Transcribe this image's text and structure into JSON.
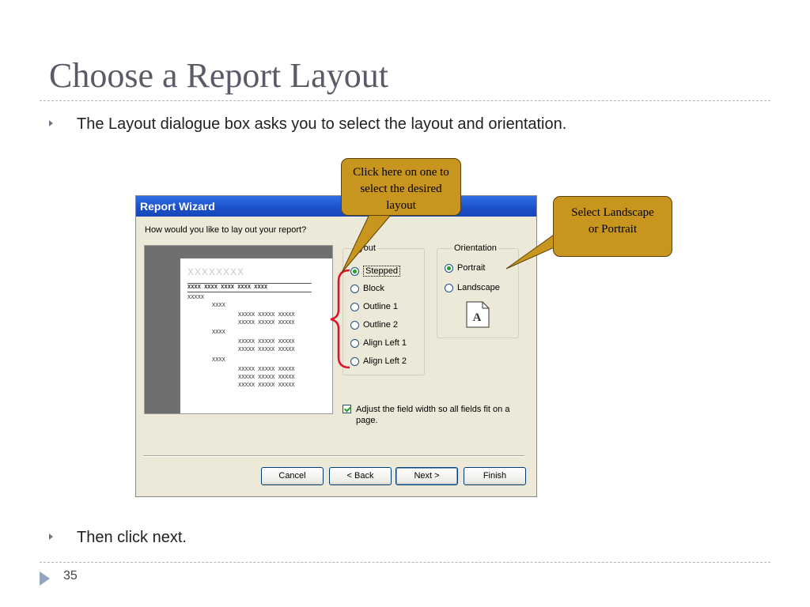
{
  "slide": {
    "title": "Choose a Report Layout",
    "bullet1": "The Layout dialogue box asks you to select the layout and orientation.",
    "bullet2": "Then click next.",
    "page_number": "35"
  },
  "dialog": {
    "title": "Report Wizard",
    "question": "How would you like to lay out your report?",
    "preview": {
      "title_placeholder": "XXXXXXXX",
      "header_row": "XXXX  XXXX  XXXX  XXXX  XXXX",
      "group_label": "XXXXX",
      "subgroup_label": "XXXX",
      "detail_row": "XXXXX  XXXXX  XXXXX"
    },
    "layout": {
      "label": "ayout",
      "options": [
        "Stepped",
        "Block",
        "Outline 1",
        "Outline 2",
        "Align Left 1",
        "Align Left 2"
      ],
      "selected": "Stepped"
    },
    "orientation": {
      "label": "Orientation",
      "options": [
        "Portrait",
        "Landscape"
      ],
      "selected": "Portrait",
      "icon_letter": "A"
    },
    "adjust_checkbox": {
      "label": "Adjust the field width so all fields fit on a page.",
      "checked": true
    },
    "buttons": {
      "cancel": "Cancel",
      "back": "< Back",
      "next": "Next >",
      "finish": "Finish"
    }
  },
  "callouts": {
    "layout_text": "Click here on one to select the desired layout",
    "orientation_text": "Select Landscape or Portrait",
    "fill_color": "#c8961f",
    "bracket_color": "#e0102a"
  }
}
